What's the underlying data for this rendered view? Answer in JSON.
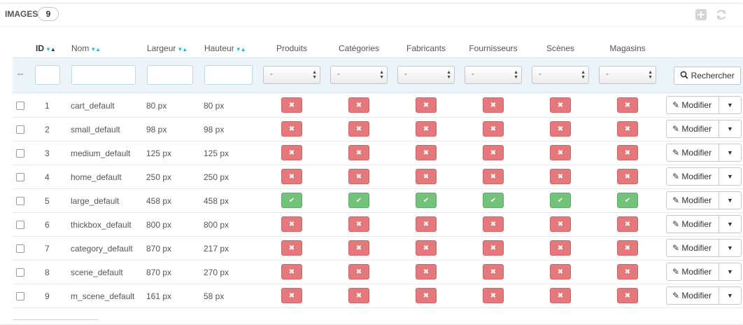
{
  "panel": {
    "title": "IMAGES",
    "count": "9"
  },
  "header_icons": {
    "add": "plus-square-icon",
    "refresh": "refresh-icon"
  },
  "columns": {
    "id": "ID",
    "name": "Nom",
    "width": "Largeur",
    "height": "Hauteur",
    "products": "Produits",
    "categories": "Catégories",
    "manufacturers": "Fabricants",
    "suppliers": "Fournisseurs",
    "scenes": "Scènes",
    "stores": "Magasins"
  },
  "filters": {
    "bulk": "--",
    "select_value": "-",
    "search_label": "Rechercher"
  },
  "actions": {
    "edit_label": "Modifier"
  },
  "colors": {
    "accent": "#25b9d7",
    "no": "#e5787b",
    "yes": "#72c279",
    "filter_bg": "#eaf4f9"
  },
  "rows": [
    {
      "id": "1",
      "name": "cart_default",
      "width": "80 px",
      "height": "80 px",
      "flags": [
        false,
        false,
        false,
        false,
        false,
        false
      ]
    },
    {
      "id": "2",
      "name": "small_default",
      "width": "98 px",
      "height": "98 px",
      "flags": [
        false,
        false,
        false,
        false,
        false,
        false
      ]
    },
    {
      "id": "3",
      "name": "medium_default",
      "width": "125 px",
      "height": "125 px",
      "flags": [
        false,
        false,
        false,
        false,
        false,
        false
      ]
    },
    {
      "id": "4",
      "name": "home_default",
      "width": "250 px",
      "height": "250 px",
      "flags": [
        false,
        false,
        false,
        false,
        false,
        false
      ]
    },
    {
      "id": "5",
      "name": "large_default",
      "width": "458 px",
      "height": "458 px",
      "flags": [
        true,
        true,
        true,
        true,
        true,
        true
      ]
    },
    {
      "id": "6",
      "name": "thickbox_default",
      "width": "800 px",
      "height": "800 px",
      "flags": [
        false,
        false,
        false,
        false,
        false,
        false
      ]
    },
    {
      "id": "7",
      "name": "category_default",
      "width": "870 px",
      "height": "217 px",
      "flags": [
        false,
        false,
        false,
        false,
        false,
        false
      ]
    },
    {
      "id": "8",
      "name": "scene_default",
      "width": "870 px",
      "height": "270 px",
      "flags": [
        false,
        false,
        false,
        false,
        false,
        false
      ]
    },
    {
      "id": "9",
      "name": "m_scene_default",
      "width": "161 px",
      "height": "58 px",
      "flags": [
        false,
        false,
        false,
        false,
        false,
        false
      ]
    }
  ]
}
